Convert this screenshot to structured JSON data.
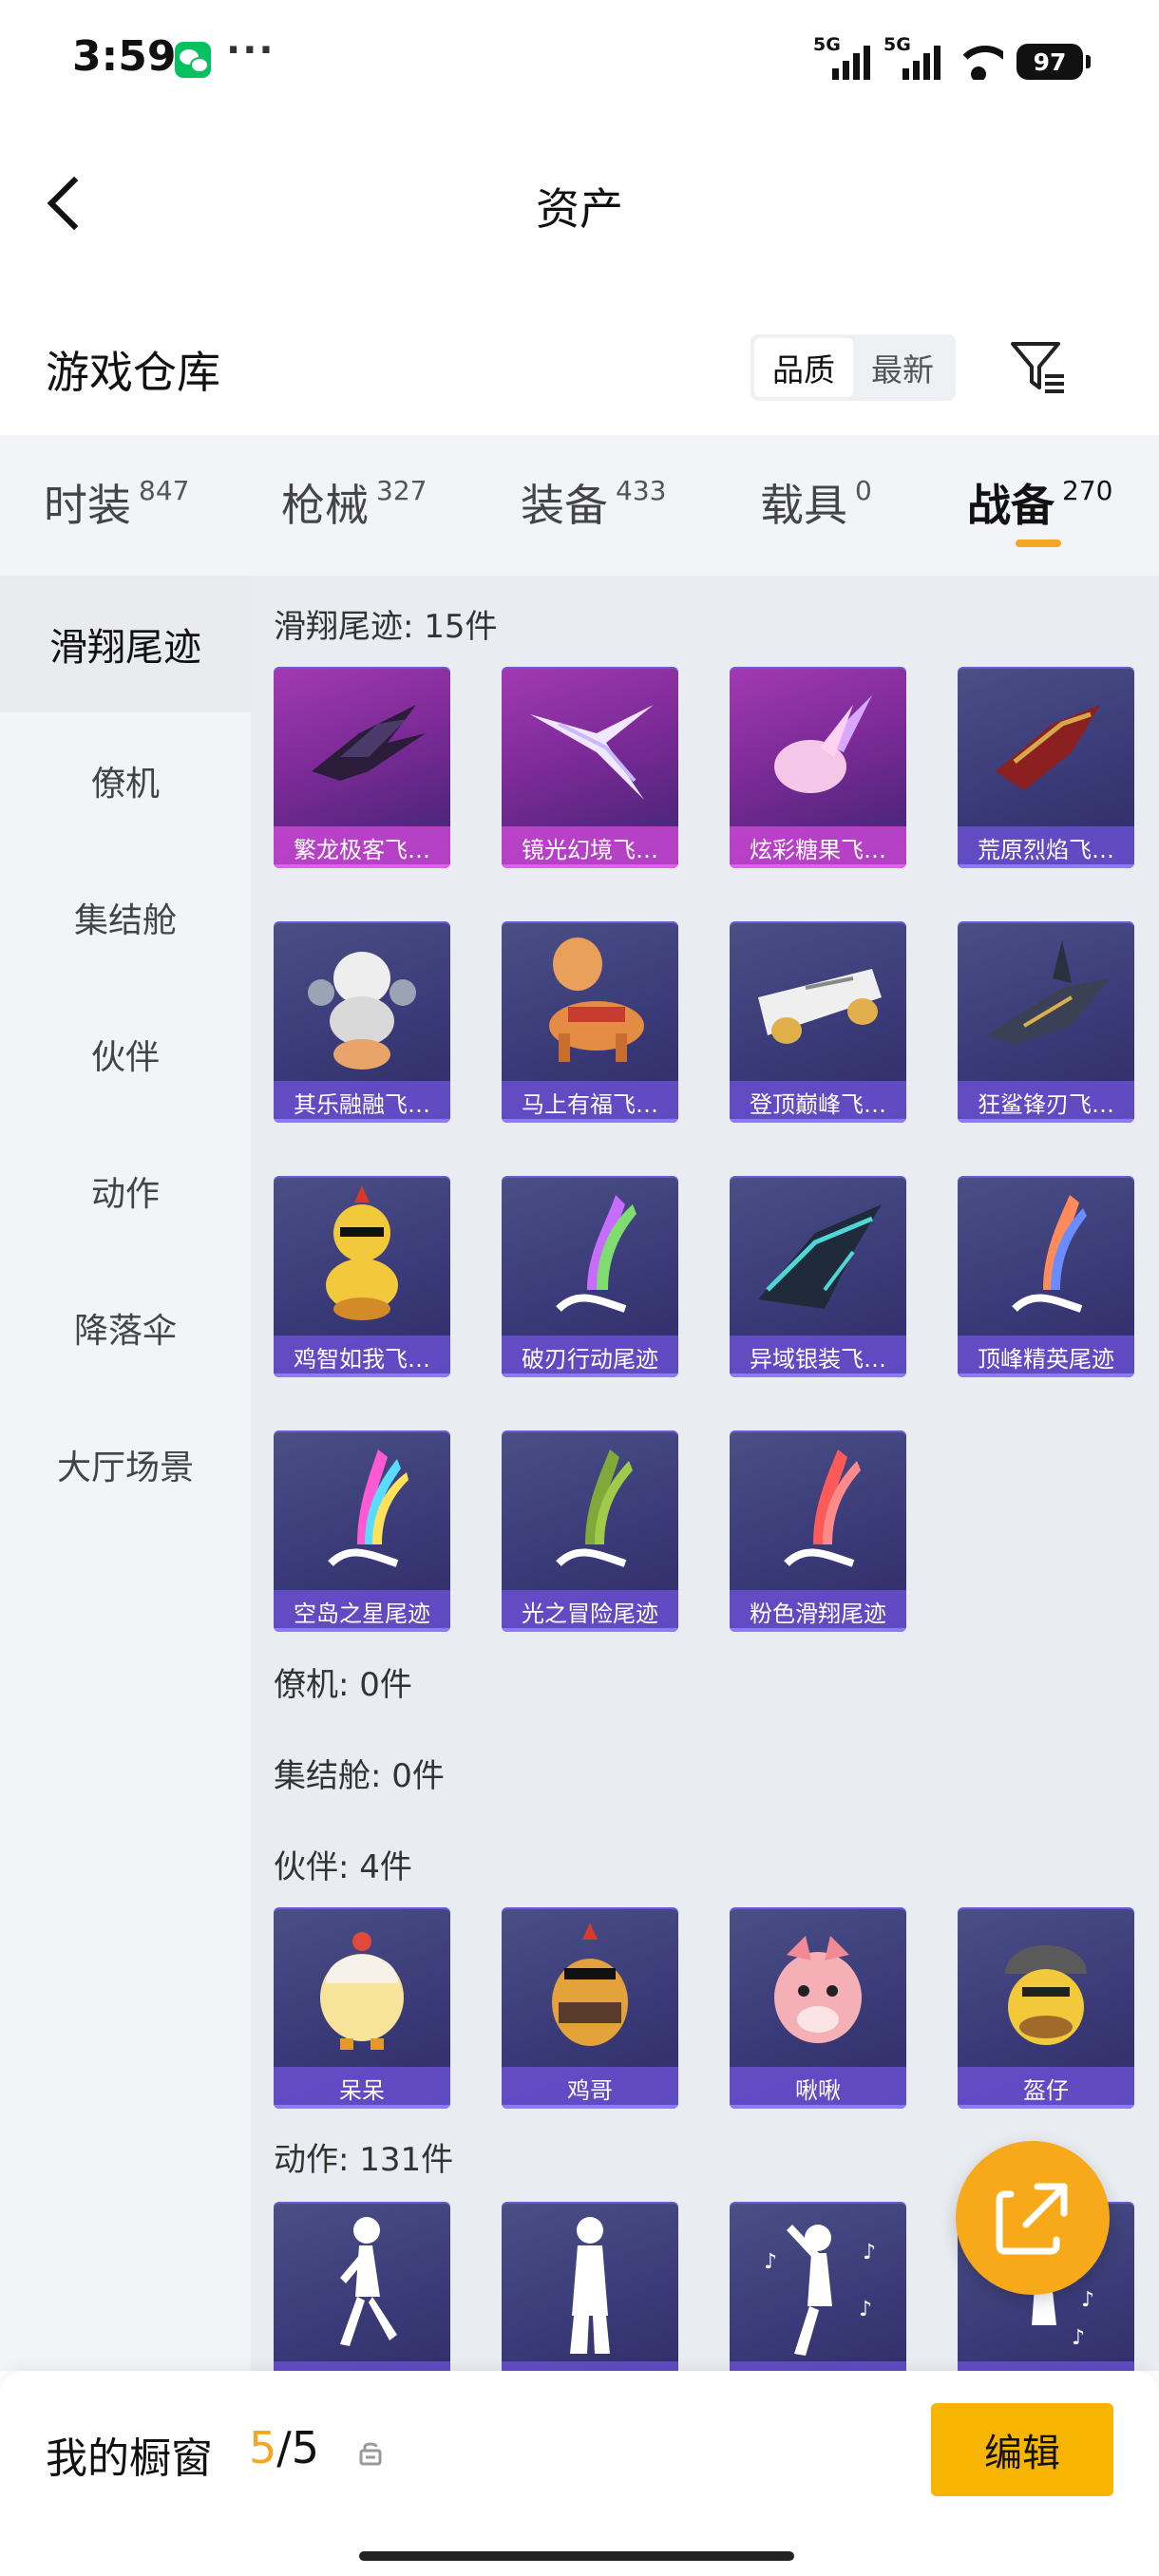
{
  "status_bar": {
    "time": "3:59",
    "signal1": "5G",
    "signal2": "5G",
    "battery": "97"
  },
  "nav": {
    "title": "资产"
  },
  "warehouse": {
    "title": "游戏仓库",
    "sort_options": [
      "品质",
      "最新"
    ],
    "active_sort": "品质"
  },
  "tabs": [
    {
      "label": "时装",
      "count": "847"
    },
    {
      "label": "枪械",
      "count": "327"
    },
    {
      "label": "装备",
      "count": "433"
    },
    {
      "label": "载具",
      "count": "0"
    },
    {
      "label": "战备",
      "count": "270"
    }
  ],
  "active_tab": "战备",
  "side_menu": [
    "滑翔尾迹",
    "僚机",
    "集结舱",
    "伙伴",
    "动作",
    "降落伞",
    "大厅场景"
  ],
  "active_side": "滑翔尾迹",
  "sections": [
    {
      "heading": "滑翔尾迹: 15件",
      "items": [
        "繁龙极客飞…",
        "镜光幻境飞…",
        "炫彩糖果飞…",
        "荒原烈焰飞…",
        "其乐融融飞…",
        "马上有福飞…",
        "登顶巅峰飞…",
        "狂鲨锋刃飞…",
        "鸡智如我飞…",
        "破刃行动尾迹",
        "异域银装飞…",
        "顶峰精英尾迹",
        "空岛之星尾迹",
        "光之冒险尾迹",
        "粉色滑翔尾迹"
      ]
    },
    {
      "heading": "僚机: 0件",
      "items": []
    },
    {
      "heading": "集结舱: 0件",
      "items": []
    },
    {
      "heading": "伙伴: 4件",
      "items": [
        "呆呆",
        "鸡哥",
        "啾啾",
        "盔仔"
      ]
    },
    {
      "heading": "动作: 131件",
      "items": [
        "",
        "",
        "",
        ""
      ]
    }
  ],
  "bottom_bar": {
    "label": "我的橱窗",
    "count_current": "5",
    "count_sep": "/",
    "count_total": "5",
    "edit_label": "编辑"
  },
  "colors": {
    "accent": "#f5a623",
    "edit_button": "#f7b400",
    "card_blue": "#3a3a78",
    "card_purple": "#a23ab3"
  }
}
